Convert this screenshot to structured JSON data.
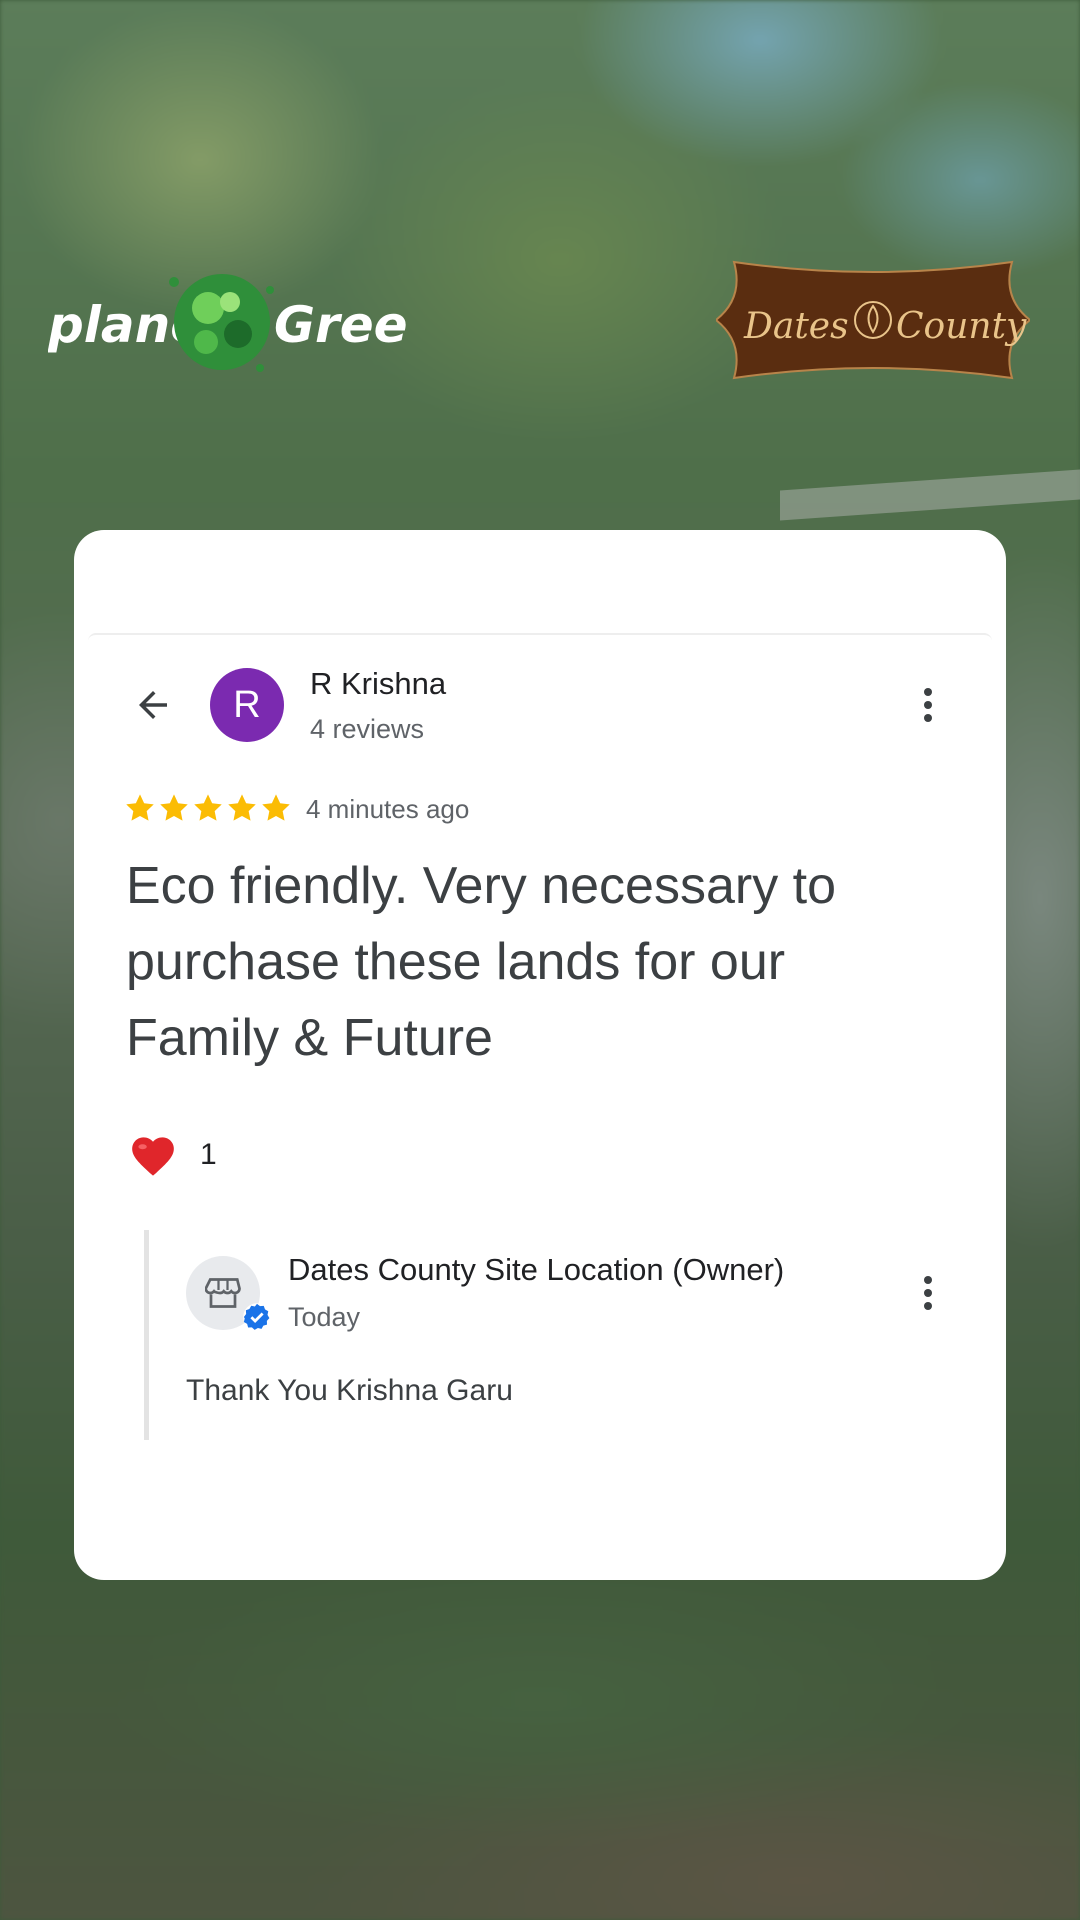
{
  "logos": {
    "left": {
      "text_1": "planet",
      "text_2": "Green",
      "icon": "green-globe-icon"
    },
    "right": {
      "text_1": "Dates",
      "text_2": "County",
      "icon": "leaf-emblem-icon",
      "color": "#5a2d10"
    }
  },
  "review": {
    "back_icon": "arrow-back-icon",
    "avatar_letter": "R",
    "avatar_color": "#7b2ab0",
    "reviewer_name": "R Krishna",
    "reviewer_reviews": "4 reviews",
    "rating": 5,
    "rating_max": 5,
    "star_color": "#fbbc04",
    "time": "4 minutes ago",
    "text": "Eco friendly. Very necessary to purchase these lands for our Family & Future",
    "reaction_icon": "heart-icon",
    "reaction_count": "1",
    "more_icon": "more-vert-icon"
  },
  "owner_reply": {
    "avatar_icon": "storefront-icon",
    "verified_icon": "verified-badge-icon",
    "name": "Dates County Site Location (Owner)",
    "time": "Today",
    "text": "Thank You Krishna Garu",
    "more_icon": "more-vert-icon"
  }
}
